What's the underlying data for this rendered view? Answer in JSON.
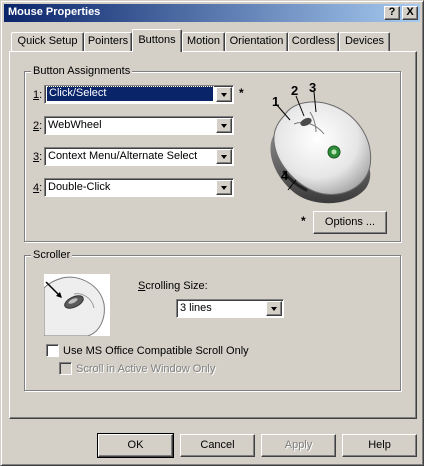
{
  "window": {
    "title": "Mouse Properties",
    "help_glyph": "?",
    "close_glyph": "X"
  },
  "tabs": [
    {
      "label": "Quick Setup",
      "active": false
    },
    {
      "label": "Pointers",
      "active": false
    },
    {
      "label": "Buttons",
      "active": true
    },
    {
      "label": "Motion",
      "active": false
    },
    {
      "label": "Orientation",
      "active": false
    },
    {
      "label": "Cordless",
      "active": false
    },
    {
      "label": "Devices",
      "active": false
    }
  ],
  "button_assignments": {
    "group_label": "Button Assignments",
    "rows": [
      {
        "number": "1",
        "value": "Click/Select",
        "selected": true
      },
      {
        "number": "2",
        "value": "WebWheel",
        "selected": false
      },
      {
        "number": "3",
        "value": "Context Menu/Alternate Select",
        "selected": false
      },
      {
        "number": "4",
        "value": "Double-Click",
        "selected": false
      }
    ],
    "star": "*",
    "options_button": "Options ...",
    "callouts": [
      "1",
      "2",
      "3",
      "4"
    ]
  },
  "scroller": {
    "group_label": "Scroller",
    "scrolling_size_label": "Scrolling Size:",
    "scrolling_size_value": "3 lines",
    "ms_office_checkbox_label": "Use MS Office Compatible Scroll Only",
    "active_window_checkbox_label": "Scroll in Active Window Only"
  },
  "footer": {
    "ok": "OK",
    "cancel": "Cancel",
    "apply": "Apply",
    "help": "Help"
  },
  "icons": {
    "mouse_illustration": "mouse-illustration-icon",
    "scroll_wheel_illustration": "scroll-wheel-illustration-icon"
  }
}
